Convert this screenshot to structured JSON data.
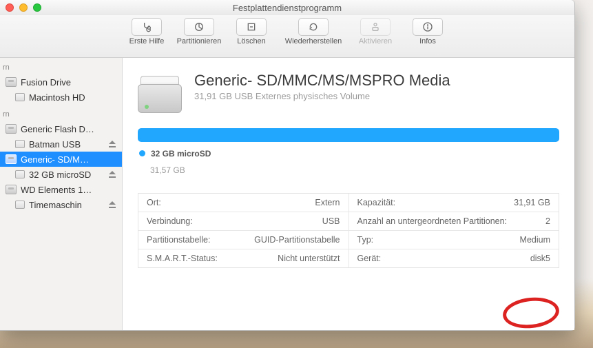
{
  "window": {
    "title": "Festplattendienstprogramm"
  },
  "toolbar": {
    "items": [
      {
        "label": "Erste Hilfe",
        "enabled": true
      },
      {
        "label": "Partitionieren",
        "enabled": true
      },
      {
        "label": "Löschen",
        "enabled": true
      },
      {
        "label": "Wiederherstellen",
        "enabled": true
      },
      {
        "label": "Aktivieren",
        "enabled": false
      },
      {
        "label": "Infos",
        "enabled": true
      }
    ]
  },
  "sidebar": {
    "sections": [
      {
        "heading": "rn",
        "items": [
          {
            "label": "Fusion Drive",
            "kind": "disk",
            "children": [
              {
                "label": "Macintosh HD",
                "kind": "vol",
                "eject": false
              }
            ]
          }
        ]
      },
      {
        "heading": "rn",
        "items": [
          {
            "label": "Generic Flash D…",
            "kind": "disk",
            "children": [
              {
                "label": "Batman USB",
                "kind": "vol",
                "eject": true
              }
            ]
          },
          {
            "label": "Generic- SD/M…",
            "kind": "disk",
            "selected": true,
            "children": [
              {
                "label": "32 GB microSD",
                "kind": "vol",
                "eject": true
              }
            ]
          },
          {
            "label": "WD Elements 1…",
            "kind": "disk",
            "children": [
              {
                "label": "Timemaschin",
                "kind": "vol",
                "eject": true
              }
            ]
          }
        ]
      }
    ]
  },
  "detail": {
    "title": "Generic- SD/MMC/MS/MSPRO Media",
    "subtitle": "31,91 GB USB Externes physisches Volume",
    "usage": {
      "segments": [
        {
          "name": "32 GB microSD",
          "size_label": "31,57 GB",
          "color": "#22a7ff",
          "fraction": 1.0
        }
      ]
    },
    "info_rows": [
      [
        {
          "k": "Ort:",
          "v": "Extern"
        },
        {
          "k": "Kapazität:",
          "v": "31,91 GB"
        }
      ],
      [
        {
          "k": "Verbindung:",
          "v": "USB"
        },
        {
          "k": "Anzahl an untergeordneten Partitionen:",
          "v": "2"
        }
      ],
      [
        {
          "k": "Partitionstabelle:",
          "v": "GUID-Partitionstabelle"
        },
        {
          "k": "Typ:",
          "v": "Medium"
        }
      ],
      [
        {
          "k": "S.M.A.R.T.-Status:",
          "v": "Nicht unterstützt"
        },
        {
          "k": "Gerät:",
          "v": "disk5"
        }
      ]
    ]
  },
  "annotation": {
    "circle_target": "disk5"
  }
}
